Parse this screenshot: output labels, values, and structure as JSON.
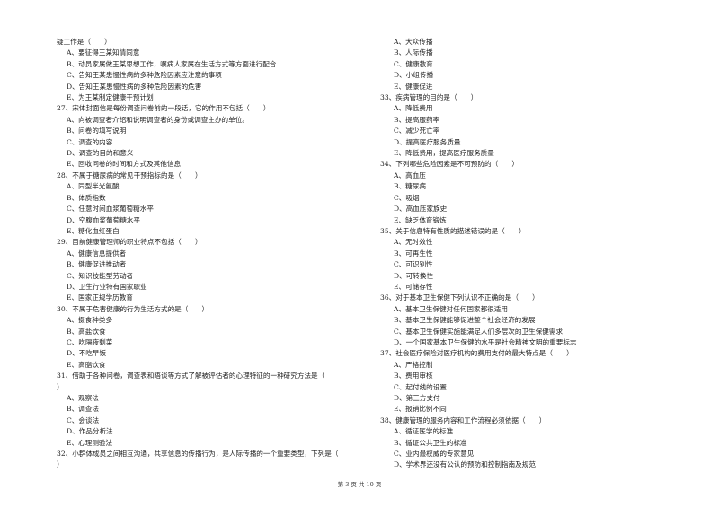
{
  "left_column": [
    {
      "type": "q",
      "text": "疑工作是（　　）"
    },
    {
      "type": "opt",
      "text": "A、要征得王某知情同意"
    },
    {
      "type": "opt",
      "text": "B、动员家属做王某思想工作，嘱病人家属在生活方式等方面进行配合"
    },
    {
      "type": "opt",
      "text": "C、告知王某患慢性病的多种危险因素应注意的事项"
    },
    {
      "type": "opt",
      "text": "D、告知王某患慢性病的多种危险因素的危害"
    },
    {
      "type": "opt",
      "text": "E、为王某制定健康干预计划"
    },
    {
      "type": "q",
      "text": "27、宋体封面信是每份调查问卷前的一段话，它的作用不包括（　　）"
    },
    {
      "type": "opt",
      "text": "A、向被调查者介绍和说明调查者的身份或调查主办的单位。"
    },
    {
      "type": "opt",
      "text": "B、问卷的填写说明"
    },
    {
      "type": "opt",
      "text": "C、调查的内容"
    },
    {
      "type": "opt",
      "text": "D、调查的目的和意义"
    },
    {
      "type": "opt",
      "text": "E、回收问卷的时间和方式及其他信息"
    },
    {
      "type": "q",
      "text": "28、不属于糖尿病的常见干预指标的是（　　）"
    },
    {
      "type": "opt",
      "text": "A、同型半光氨酸"
    },
    {
      "type": "opt",
      "text": "B、体质指数"
    },
    {
      "type": "opt",
      "text": "C、任意时间血浆葡萄糖水平"
    },
    {
      "type": "opt",
      "text": "D、空腹血浆葡萄糖水平"
    },
    {
      "type": "opt",
      "text": "E、糖化血红蛋白"
    },
    {
      "type": "q",
      "text": "29、目前健康管理师的职业特点不包括（　　）"
    },
    {
      "type": "opt",
      "text": "A、健康信息提供者"
    },
    {
      "type": "opt",
      "text": "B、健康促进推动者"
    },
    {
      "type": "opt",
      "text": "C、知识技能型劳动者"
    },
    {
      "type": "opt",
      "text": "D、卫生行业特有国家职业"
    },
    {
      "type": "opt",
      "text": "E、国家正规学历教育"
    },
    {
      "type": "q",
      "text": "30、不属于危害健康的行为生活方式的是（　　）"
    },
    {
      "type": "opt",
      "text": "A、摄食种类多"
    },
    {
      "type": "opt",
      "text": "B、高盐饮食"
    },
    {
      "type": "opt",
      "text": "C、吃隔夜剩菜"
    },
    {
      "type": "opt",
      "text": "D、不吃早饭"
    },
    {
      "type": "opt",
      "text": "E、高脂饮食"
    },
    {
      "type": "q",
      "text": "31、借助于各种问卷，调查表和晤谈等方式了解被评估者的心理特征的一种研究方法是（"
    },
    {
      "type": "q",
      "text": "）"
    },
    {
      "type": "opt",
      "text": "A、观察法"
    },
    {
      "type": "opt",
      "text": "B、调查法"
    },
    {
      "type": "opt",
      "text": "C、会谈法"
    },
    {
      "type": "opt",
      "text": "D、作品分析法"
    },
    {
      "type": "opt",
      "text": "E、心理测验法"
    },
    {
      "type": "q",
      "text": "32、小群体成员之间相互沟通，共享信息的传播行为，是人际传播的一个重要类型，下列是（"
    },
    {
      "type": "q",
      "text": "）"
    }
  ],
  "right_column": [
    {
      "type": "opt",
      "text": "A、大众传播"
    },
    {
      "type": "opt",
      "text": "B、人际传播"
    },
    {
      "type": "opt",
      "text": "C、健康教育"
    },
    {
      "type": "opt",
      "text": "D、小组传播"
    },
    {
      "type": "opt",
      "text": "E、健康促进"
    },
    {
      "type": "q",
      "text": "33、疾病管理的目的是（　　）"
    },
    {
      "type": "opt",
      "text": "A、降低费用"
    },
    {
      "type": "opt",
      "text": "B、提高服药率"
    },
    {
      "type": "opt",
      "text": "C、减少死亡率"
    },
    {
      "type": "opt",
      "text": "D、提高医疗服务质量"
    },
    {
      "type": "opt",
      "text": "E、降低费用，提高医疗服务质量"
    },
    {
      "type": "q",
      "text": "34、下列哪些危险因素是不可预防的（　　）"
    },
    {
      "type": "opt",
      "text": "A、高血压"
    },
    {
      "type": "opt",
      "text": "B、糖尿病"
    },
    {
      "type": "opt",
      "text": "C、吸烟"
    },
    {
      "type": "opt",
      "text": "D、高血压家族史"
    },
    {
      "type": "opt",
      "text": "E、缺乏体育锻炼"
    },
    {
      "type": "q",
      "text": "35、关于信息特有性质的描述错误的是（　　）"
    },
    {
      "type": "opt",
      "text": "A、无时效性"
    },
    {
      "type": "opt",
      "text": "B、可再生性"
    },
    {
      "type": "opt",
      "text": "C、可识别性"
    },
    {
      "type": "opt",
      "text": "D、可转换性"
    },
    {
      "type": "opt",
      "text": "E、可储存性"
    },
    {
      "type": "q",
      "text": "36、对于基本卫生保健下列认识不正确的是（　　）"
    },
    {
      "type": "opt",
      "text": "A、基本卫生保健对任何国家都很适用"
    },
    {
      "type": "opt",
      "text": "B、基本卫生保健能够促进整个社会经济的发展"
    },
    {
      "type": "opt",
      "text": "C、基本卫生保健实施能满足人们多层次的卫生保健需求"
    },
    {
      "type": "opt",
      "text": "D、一个国家基本卫生保健的水平是社会精神文明的重要标志"
    },
    {
      "type": "q",
      "text": "37、社会医疗保险对医疗机构的费用支付的最大特点是（　　）"
    },
    {
      "type": "opt",
      "text": "A、严格控制"
    },
    {
      "type": "opt",
      "text": "B、费用审核"
    },
    {
      "type": "opt",
      "text": "C、起付线的设置"
    },
    {
      "type": "opt",
      "text": "D、第三方支付"
    },
    {
      "type": "opt",
      "text": "E、报销比例不同"
    },
    {
      "type": "q",
      "text": "38、健康管理的服务内容和工作流程必须依据（　　）"
    },
    {
      "type": "opt",
      "text": "A、循证医学的标准"
    },
    {
      "type": "opt",
      "text": "B、循证公共卫生的标准"
    },
    {
      "type": "opt",
      "text": "C、业内最权威的专家意见"
    },
    {
      "type": "opt",
      "text": "D、学术界还没有公认的预防和控制指南及规范"
    }
  ],
  "footer": {
    "page_label": "第 3 页 共 10 页"
  }
}
